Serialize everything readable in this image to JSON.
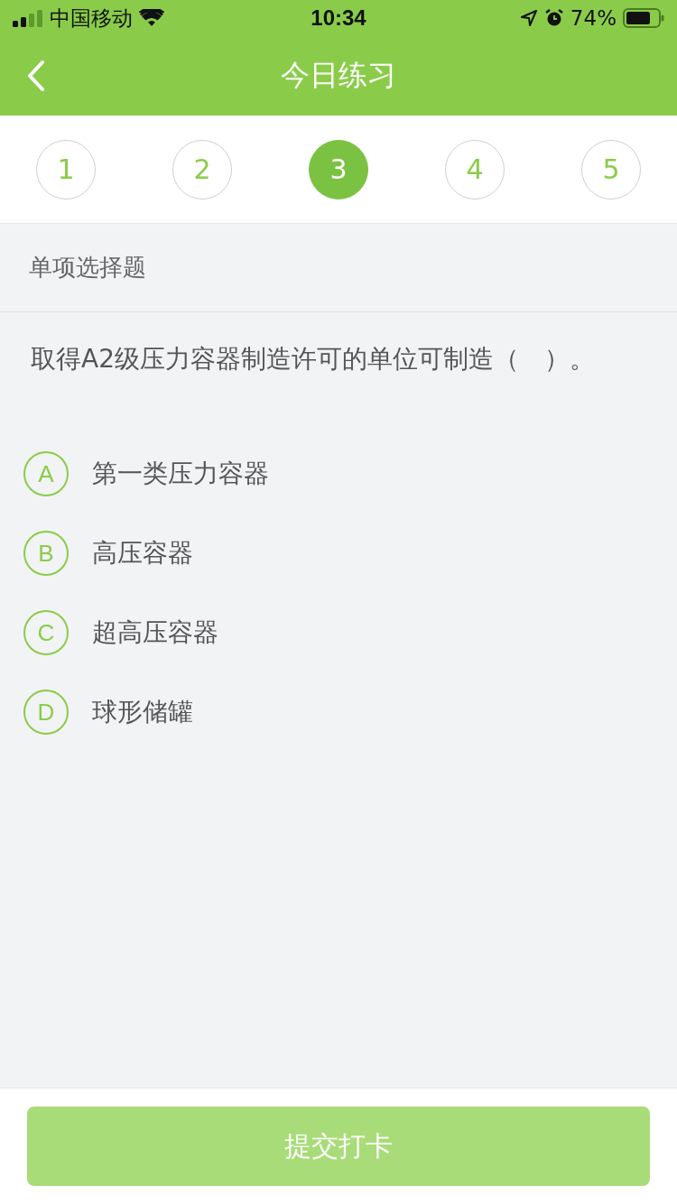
{
  "status_bar": {
    "carrier": "中国移动",
    "time": "10:34",
    "battery": "74%"
  },
  "nav": {
    "title": "今日练习"
  },
  "steps": [
    {
      "label": "1",
      "selected": false
    },
    {
      "label": "2",
      "selected": false
    },
    {
      "label": "3",
      "selected": true
    },
    {
      "label": "4",
      "selected": false
    },
    {
      "label": "5",
      "selected": false
    }
  ],
  "section": "单项选择题",
  "question": "取得A2级压力容器制造许可的单位可制造（　）。",
  "options": [
    {
      "letter": "A",
      "text": "第一类压力容器",
      "selected": false
    },
    {
      "letter": "B",
      "text": "高压容器",
      "selected": false
    },
    {
      "letter": "C",
      "text": "超高压容器",
      "selected": false
    },
    {
      "letter": "D",
      "text": "球形储罐",
      "selected": false
    }
  ],
  "submit": {
    "label": "提交打卡",
    "disabled": true
  }
}
